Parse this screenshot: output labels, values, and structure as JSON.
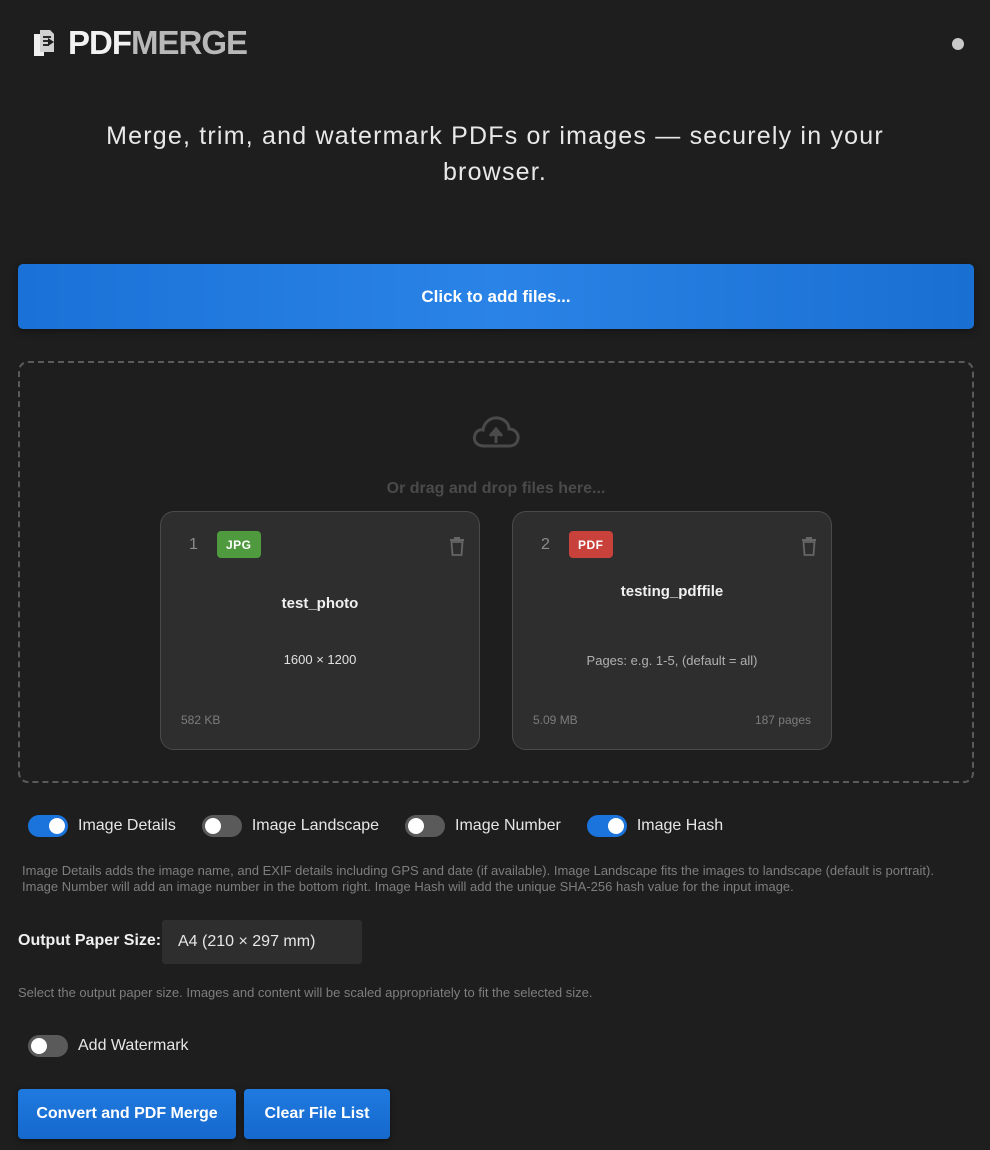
{
  "header": {
    "logo_pdf": "PDF",
    "logo_merge": "MERGE",
    "logo_icon": "document-stack-icon",
    "status_icon": "status-dot-icon"
  },
  "tagline": "Merge, trim, and watermark PDFs or images — securely in your browser.",
  "add_files_label": "Click to add files...",
  "dropzone": {
    "icon": "cloud-upload-icon",
    "text": "Or drag and drop files here..."
  },
  "files": [
    {
      "number": "1",
      "type": "JPG",
      "name": "test_photo",
      "dimensions": "1600 × 1200",
      "size": "582 KB"
    },
    {
      "number": "2",
      "type": "PDF",
      "name": "testing_pdffile",
      "pages_placeholder": "Pages: e.g. 1-5, (default = all)",
      "size": "5.09 MB",
      "page_count": "187 pages"
    }
  ],
  "options": [
    {
      "label": "Image Details",
      "on": true
    },
    {
      "label": "Image Landscape",
      "on": false
    },
    {
      "label": "Image Number",
      "on": false
    },
    {
      "label": "Image Hash",
      "on": true
    }
  ],
  "options_help": "Image Details adds the image name, and EXIF details including GPS and date (if available). Image Landscape fits the images to landscape (default is portrait). Image Number will add an image number in the bottom right. Image Hash will add the unique SHA-256 hash value for the input image.",
  "paper": {
    "label": "Output Paper Size:",
    "selected": "A4 (210 × 297 mm)",
    "help": "Select the output paper size. Images and content will be scaled appropriately to fit the selected size."
  },
  "watermark": {
    "label": "Add Watermark",
    "on": false
  },
  "actions": {
    "convert_label": "Convert and PDF Merge",
    "clear_label": "Clear File List"
  },
  "colors": {
    "accent": "#1a74dc",
    "jpg_badge": "#4f9a3e",
    "pdf_badge": "#c8413a",
    "background": "#1e1e1e"
  }
}
